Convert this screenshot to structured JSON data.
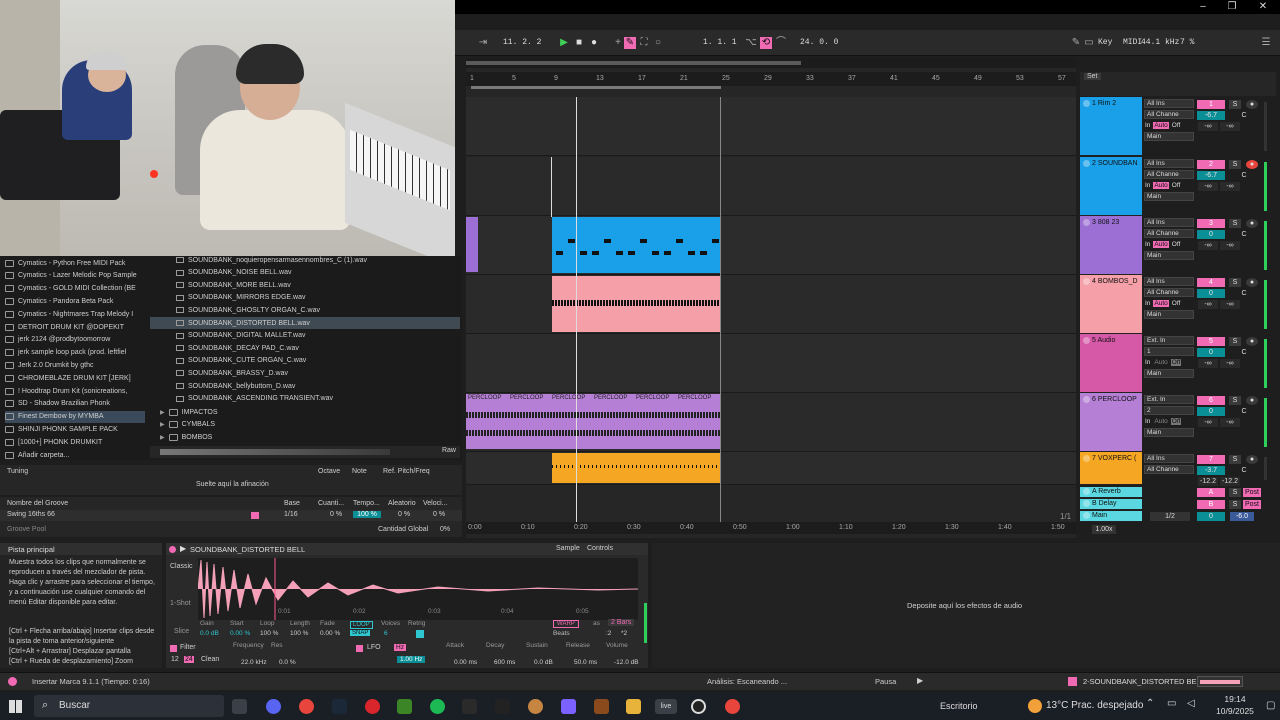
{
  "transport": {
    "tempo_pos": "11.  2.  2",
    "arrangement_pos": "1.  1.  1",
    "loop_length": "24.  0.  0",
    "key_label": "Key",
    "midi_label": "MIDI",
    "sample_rate": "44.1 kHz",
    "cpu": "7 %"
  },
  "browser": {
    "collections": [
      "Cymatics - Python Free MIDI Pack",
      "Cymatics - Lazer Melodic Pop Sample",
      "Cymatics - GOLD MIDI Collection (BE",
      "Cymatics - Pandora Beta Pack",
      "Cymatics - Nightmares Trap Melody I",
      "DETROIT DRUM KIT @DOPEKIT",
      "jerk 2124 @prodbytoomorrow",
      "jerk sample loop pack (prod. leftfiel",
      "Jerk 2.0 Drumkit by gthc",
      "CHROMEBLAZE DRUM KIT [JERK]",
      "! Hoodtrap Drum Kit (sonicreations,",
      "SD - Shadow Brazilian Phonk",
      "Finest Dembow by MYMBA",
      "SHINJI PHONK SAMPLE PACK",
      "[1000+] PHONK DRUMKIT",
      "Añadir carpeta..."
    ],
    "files": [
      "SOUNDBANK_noquieropensarmasennombres_C (1).wav",
      "SOUNDBANK_NOISE BELL.wav",
      "SOUNDBANK_MORE BELL.wav",
      "SOUNDBANK_MIRRORS EDGE.wav",
      "SOUNDBANK_GHOSLTY ORGAN_C.wav",
      "SOUNDBANK_DISTORTED BELL.wav",
      "SOUNDBANK_DIGITAL MALLET.wav",
      "SOUNDBANK_DECAY PAD_C.wav",
      "SOUNDBANK_CUTE ORGAN_C.wav",
      "SOUNDBANK_BRASSY_D.wav",
      "SOUNDBANK_bellybuttom_D.wav",
      "SOUNDBANK_ASCENDING TRANSIENT.wav"
    ],
    "folders": [
      "IMPACTOS",
      "CYMBALS",
      "BOMBOS"
    ],
    "raw_label": "Raw"
  },
  "tuning": {
    "title": "Tuning",
    "col_octave": "Octave",
    "col_note": "Note",
    "col_ref": "Ref. Pitch/Freq",
    "drop_text": "Suelte aquí la afinación"
  },
  "groove": {
    "col_name": "Nombre del Groove",
    "col_base": "Base",
    "col_quant": "Cuanti...",
    "col_tempo": "Tempo...",
    "col_random": "Aleatorio",
    "col_vel": "Veloci...",
    "row_name": "Swing 16ths 66",
    "row_base": "1/16",
    "row_quant": "0 %",
    "row_tempo": "100 %",
    "row_random": "0 %",
    "row_vel": "0 %",
    "pool_label": "Groove Pool",
    "global_label": "Cantidad Global",
    "global_value": "0%"
  },
  "info": {
    "title": "Pista principal",
    "body1": "Muestra todos los clips que normalmente se reproducen a través del mezclador de pista. Haga clic y arrastre para seleccionar el tiempo, y a continuación use cualquier comando del menú Editar disponible para editar.",
    "body2": "[Ctrl + Flecha arriba/abajo] Insertar clips desde la pista de toma anterior/siguiente\n[Ctrl+Alt + Arrastrar] Desplazar pantalla\n[Ctrl + Rueda de desplazamiento] Zoom"
  },
  "clip": {
    "name": "SOUNDBANK_DISTORTED BELL",
    "tab_sample": "Sample",
    "tab_controls": "Controls",
    "mode_classic": "Classic",
    "mode_1shot": "1-Shot",
    "mode_slice": "Slice",
    "timeline": [
      "0:01",
      "0:02",
      "0:03",
      "0:04",
      "0:05"
    ],
    "gain_label": "Gain",
    "gain": "0.0 dB",
    "start_label": "Start",
    "start": "0.00 %",
    "loop_label": "Loop",
    "loop": "100 %",
    "length_label": "Length",
    "length": "100 %",
    "fade_label": "Fade",
    "fade": "0.00 %",
    "voices_label": "Voices",
    "voices": "6",
    "retrig_label": "Retrig",
    "warp_label": "WARP",
    "as_label": "as",
    "bars": "2 Bars",
    "beats_label": "Beats",
    "div_half": ":2",
    "div_double": "*2",
    "filter_label": "Filter",
    "filter_12": "12",
    "filter_24": "24",
    "filter_clean": "Clean",
    "freq_label": "Frequency",
    "freq": "22.0 kHz",
    "res_label": "Res",
    "res": "0.0 %",
    "lfo_label": "LFO",
    "lfo_hz": "Hz",
    "lfo_rate": "1.00 Hz",
    "attack_label": "Attack",
    "attack": "0.00 ms",
    "decay_label": "Decay",
    "decay": "600 ms",
    "sustain_label": "Sustain",
    "sustain": "0.0 dB",
    "release_label": "Release",
    "release": "50.0 ms",
    "volume_label": "Volume",
    "volume": "-12.0 dB"
  },
  "devices": {
    "drop_text": "Deposite aquí los efectos de audio"
  },
  "arrangement": {
    "bars": [
      "1",
      "5",
      "9",
      "13",
      "17",
      "21",
      "25",
      "29",
      "33",
      "37",
      "41",
      "45",
      "49",
      "53",
      "57"
    ],
    "times": [
      "0:00",
      "0:10",
      "0:20",
      "0:30",
      "0:40",
      "0:50",
      "1:00",
      "1:10",
      "1:20",
      "1:30",
      "1:40",
      "1:50"
    ],
    "set_label": "Set",
    "page": "1/1",
    "zoom": "1.00x",
    "perc_clip": "PERCLOOP"
  },
  "tracks": [
    {
      "num": "1",
      "name": "1 Rim 2",
      "input": "All Ins",
      "chan": "All Channe",
      "vol": "-6.7",
      "pan": "C",
      "send": "-∞",
      "color": "#1aa0e8"
    },
    {
      "num": "2",
      "name": "2 SOUNDBAN",
      "input": "All Ins",
      "chan": "All Channe",
      "vol": "-6.7",
      "pan": "C",
      "send": "-∞",
      "color": "#1aa0e8"
    },
    {
      "num": "3",
      "name": "3 808 23",
      "input": "All Ins",
      "chan": "All Channe",
      "vol": "0",
      "pan": "C",
      "send": "-∞",
      "color": "#9b6fd3"
    },
    {
      "num": "4",
      "name": "4 BOMBOS_D",
      "input": "All Ins",
      "chan": "All Channe",
      "vol": "0",
      "pan": "C",
      "send": "-∞",
      "color": "#f5a0a8"
    },
    {
      "num": "5",
      "name": "5 Audio",
      "input": "Ext. In",
      "chan": "1",
      "vol": "0",
      "pan": "C",
      "send": "-∞",
      "color": "#d659a8"
    },
    {
      "num": "6",
      "name": "6 PERCLOOP",
      "input": "Ext. In",
      "chan": "2",
      "vol": "0",
      "pan": "C",
      "send": "-∞",
      "color": "#b67fd6"
    },
    {
      "num": "7",
      "name": "7 VOXPERC (",
      "input": "All Ins",
      "chan": "All Channe",
      "vol": "-3.7",
      "pan": "C",
      "send": "-12.2",
      "color": "#f5a623"
    }
  ],
  "returns": [
    {
      "letter": "A",
      "name": "A Reverb",
      "post": "Post"
    },
    {
      "letter": "B",
      "name": "B Delay",
      "post": "Post"
    }
  ],
  "master": {
    "name": "Main",
    "div": "1/2",
    "vol": "0",
    "peak": "-6.0"
  },
  "io_labels": {
    "in": "In",
    "auto": "Auto",
    "off": "Off",
    "main": "Main",
    "s": "S",
    "c": "C"
  },
  "status": {
    "left": "Insertar Marca 9.1.1 (Tiempo: 0:16)",
    "mid": "Análisis: Escaneando ...",
    "pause": "Pausa",
    "track": "2-SOUNDBANK_DISTORTED BELL"
  },
  "taskbar": {
    "search": "Buscar",
    "desk": "Escritorio",
    "weather": "13°C  Prac. despejado",
    "time": "19:14",
    "date": "10/9/2025"
  }
}
